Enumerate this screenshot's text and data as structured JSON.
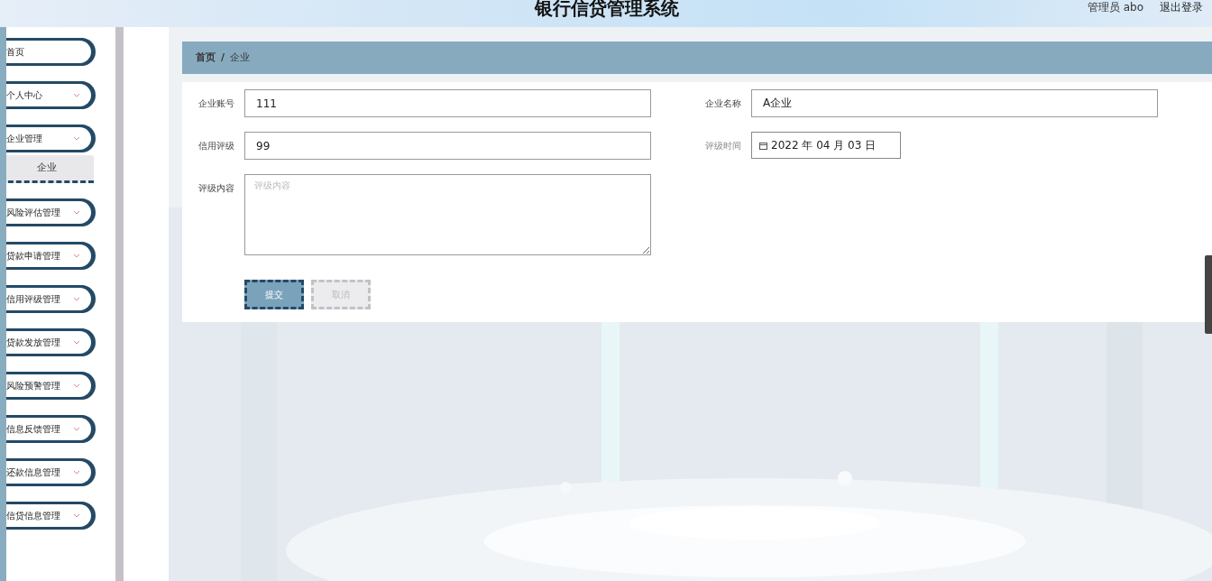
{
  "header": {
    "title": "银行信贷管理系统",
    "user": "管理员 abo",
    "logout": "退出登录"
  },
  "sidebar": {
    "items": [
      {
        "label": "首页",
        "kind": "link"
      },
      {
        "label": "个人中心",
        "kind": "menu"
      },
      {
        "label": "企业管理",
        "kind": "menu",
        "children": [
          {
            "label": "企业",
            "selected": true
          }
        ]
      },
      {
        "label": "风险评估管理",
        "kind": "menu"
      },
      {
        "label": "贷款申请管理",
        "kind": "menu"
      },
      {
        "label": "信用评级管理",
        "kind": "menu"
      },
      {
        "label": "贷款发放管理",
        "kind": "menu"
      },
      {
        "label": "风险预警管理",
        "kind": "menu"
      },
      {
        "label": "信息反馈管理",
        "kind": "menu"
      },
      {
        "label": "还款信息管理",
        "kind": "menu"
      },
      {
        "label": "信贷信息管理",
        "kind": "menu"
      }
    ]
  },
  "breadcrumb": {
    "items": [
      "首页",
      "企业"
    ],
    "separator": "/"
  },
  "form": {
    "fields": [
      {
        "label": "企业账号",
        "kind": "text",
        "value": "111"
      },
      {
        "label": "企业名称",
        "kind": "text",
        "value": "A企业"
      },
      {
        "label": "信用评级",
        "kind": "text",
        "value": "99"
      },
      {
        "label": "评级时间",
        "kind": "date",
        "value": "2022 年 04 月 03 日"
      },
      {
        "label": "评级内容",
        "kind": "textarea",
        "placeholder": "评级内容"
      }
    ],
    "buttons": [
      {
        "label": "提交",
        "kind": "primary"
      },
      {
        "label": "取消",
        "kind": "cancel"
      }
    ]
  }
}
